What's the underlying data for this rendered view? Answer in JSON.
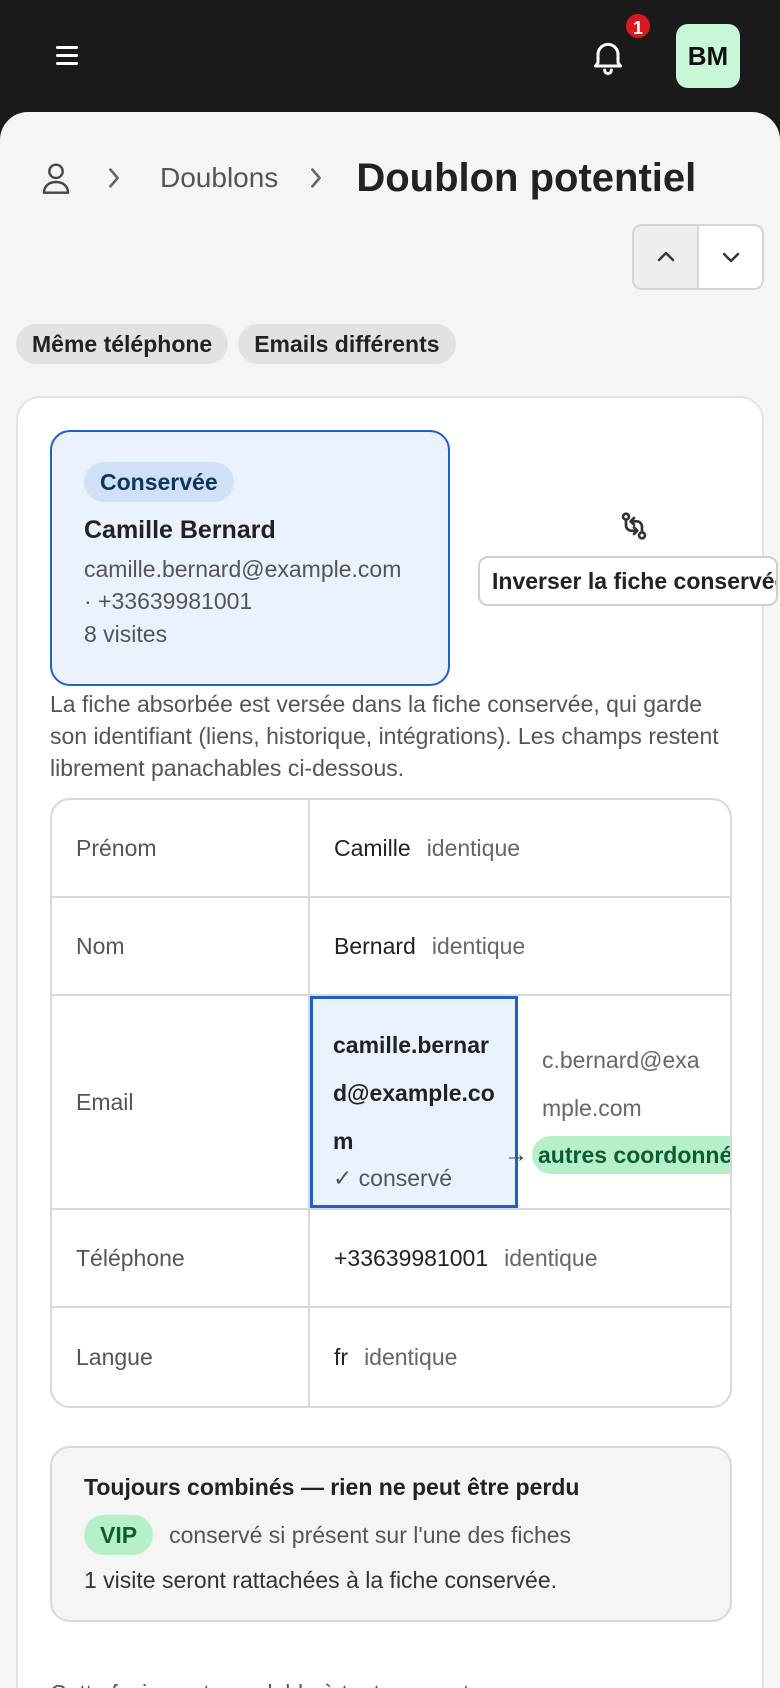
{
  "header": {
    "notifications_count": "1",
    "avatar_initials": "BM",
    "icons": [
      "menu-icon",
      "bell-icon"
    ]
  },
  "breadcrumb": {
    "root_icon": "user-icon",
    "link": "Doublons",
    "current": "Doublon potentiel"
  },
  "chips": [
    "Même téléphone",
    "Emails différents"
  ],
  "kept_record": {
    "badge": "Conservée",
    "name": "Camille Bernard",
    "email": "camille.bernard@example.com",
    "phone": "· +33639981001",
    "visits": "8 visites"
  },
  "swap_button": "Inverser la fiche conservée",
  "explanation": "La fiche absorbée est versée dans la fiche conservée, qui garde son identifiant (liens, historique, intégrations). Les champs restent librement panachables ci-dessous.",
  "fields": {
    "same_label": "identique",
    "firstname": {
      "label": "Prénom",
      "value": "Camille"
    },
    "lastname": {
      "label": "Nom",
      "value": "Bernard"
    },
    "email": {
      "label": "Email",
      "kept_value": "camille.bernard@example.com",
      "kept_note": "✓ conservé",
      "alt_value": "c.bernard@example.com",
      "arrow": "→",
      "alt_tag": "autres coordonnées"
    },
    "phone": {
      "label": "Téléphone",
      "value": "+33639981001"
    },
    "language": {
      "label": "Langue",
      "value": "fr"
    }
  },
  "combined": {
    "title": "Toujours combinés — rien ne peut être perdu",
    "vip_label": "VIP",
    "vip_text": "conservé si présent sur l'une des fiches",
    "visits_text": "1 visite seront rattachées à la fiche conservée."
  },
  "footer_note": "Cette fusion est annulable à tout moment."
}
